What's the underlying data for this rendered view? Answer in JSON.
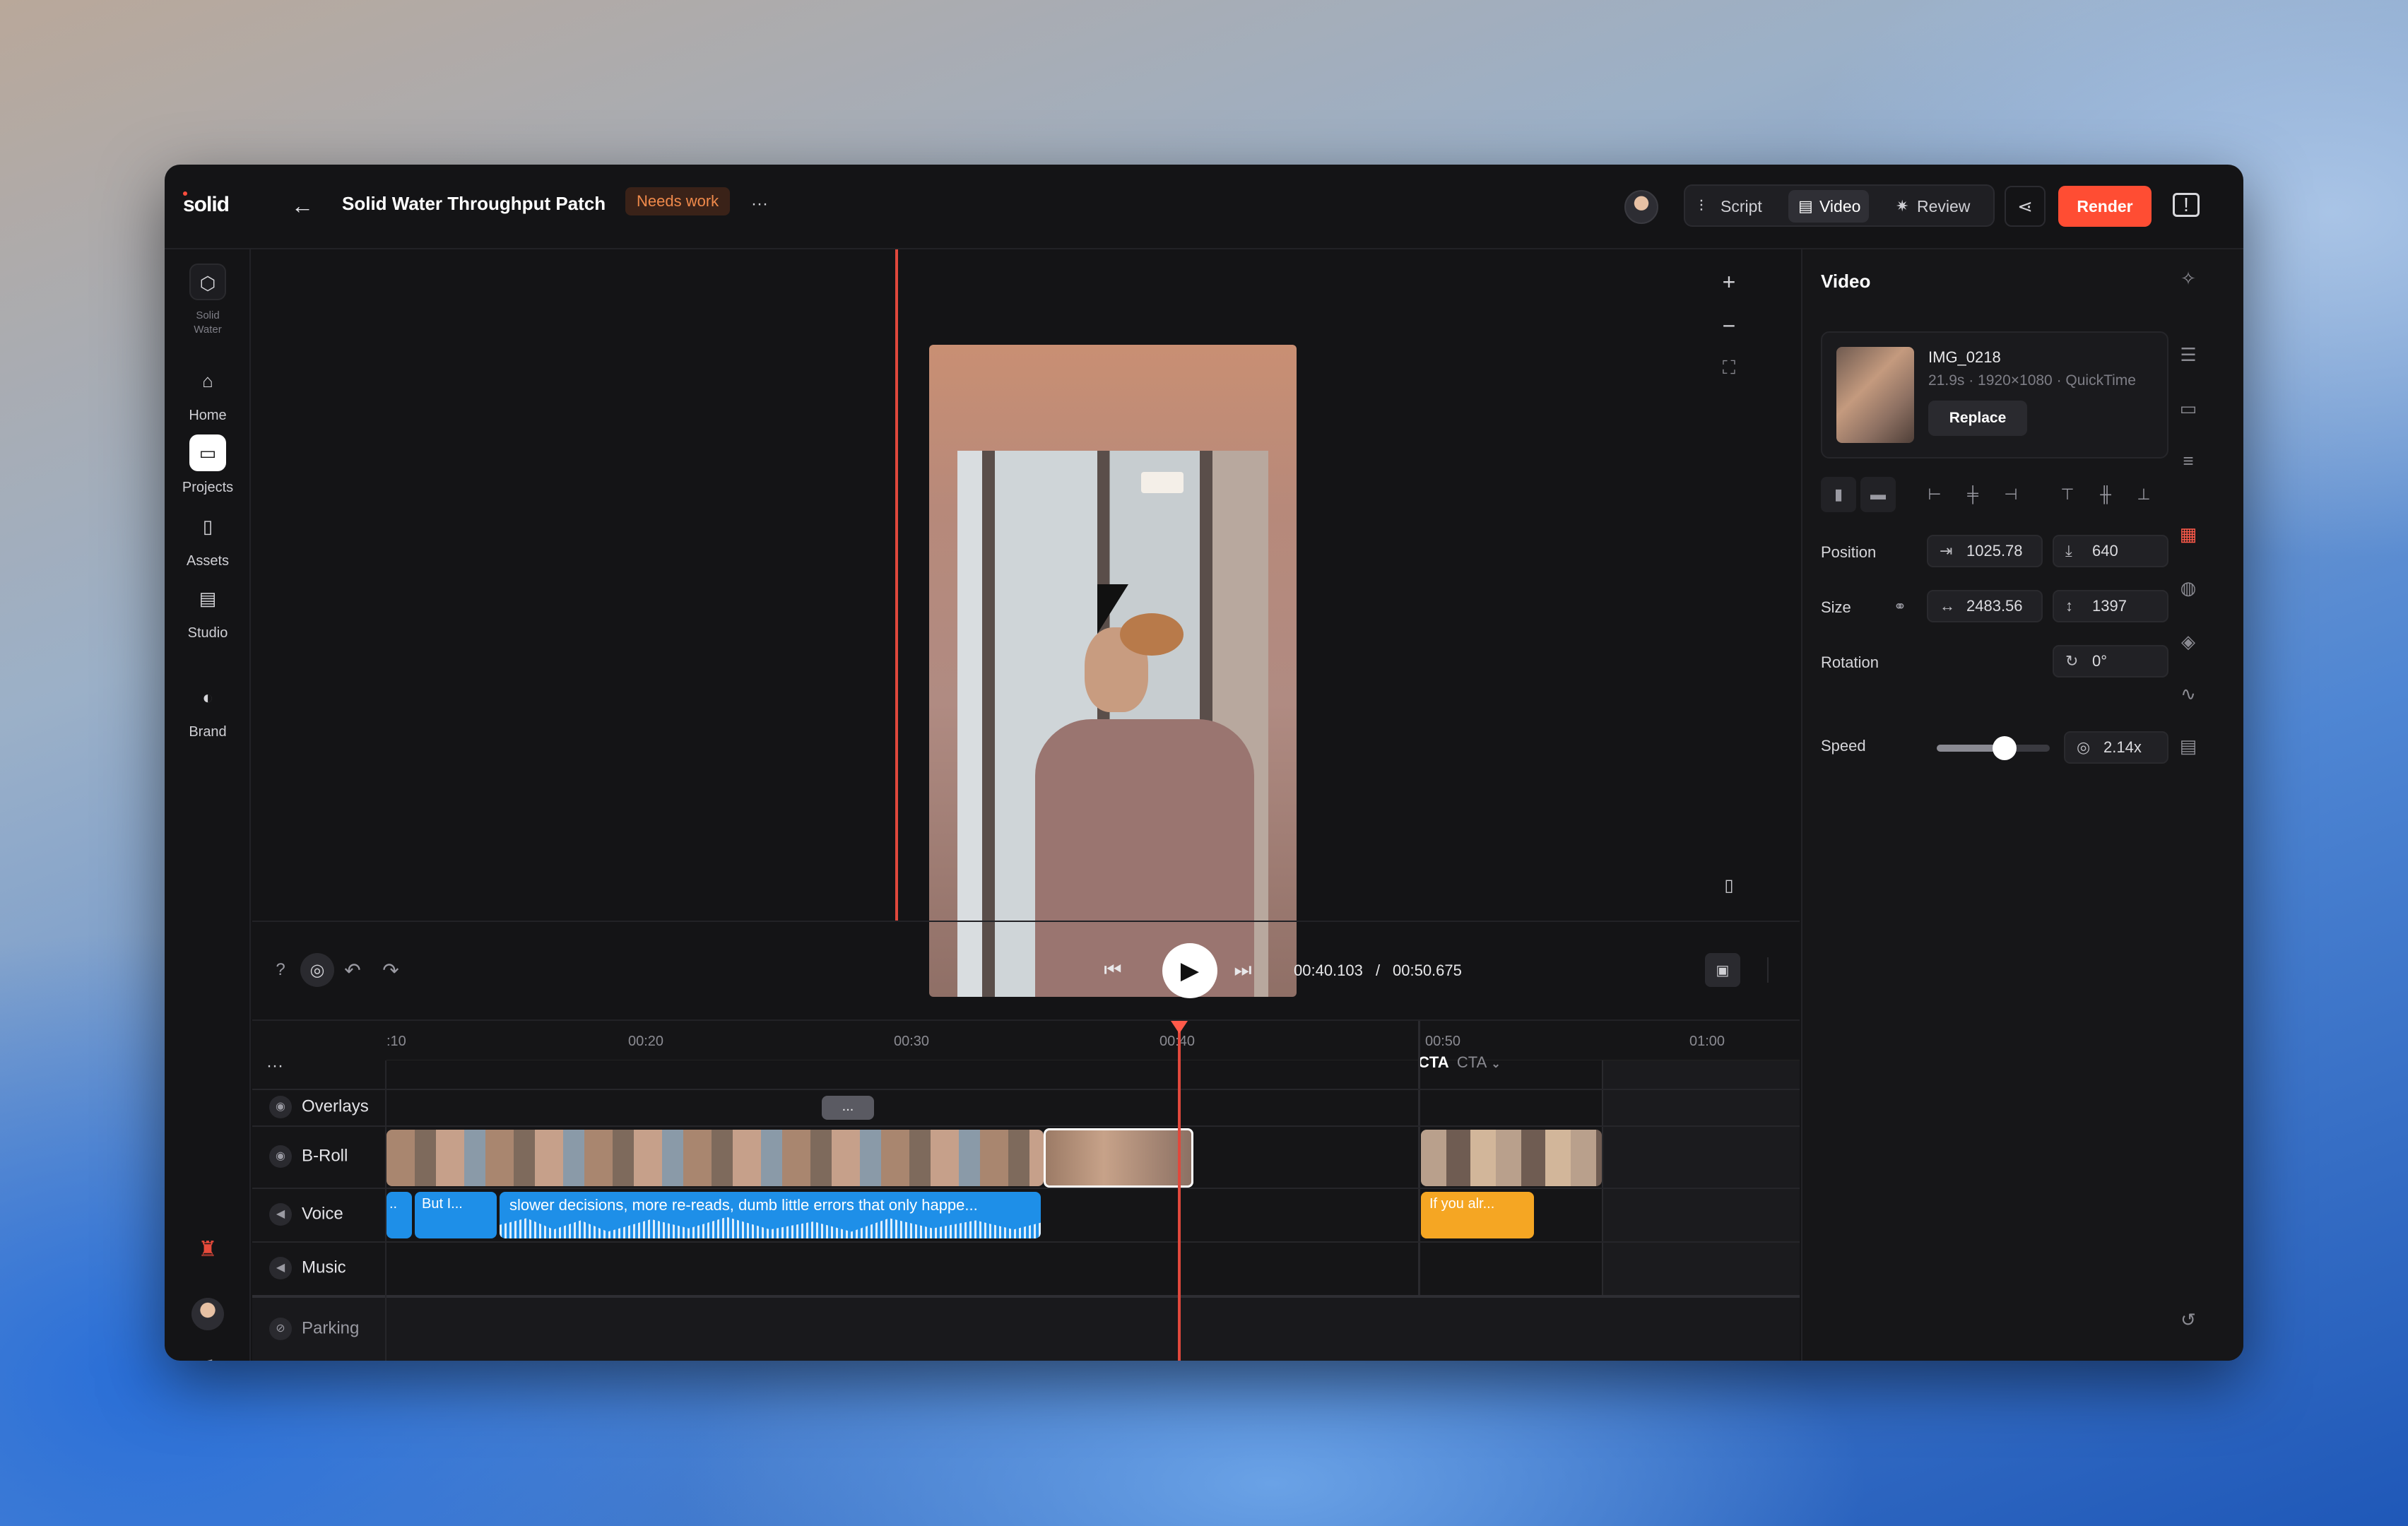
{
  "app": {
    "logo": "solid"
  },
  "header": {
    "title": "Solid Water Throughput Patch",
    "status": "Needs work",
    "more": "···",
    "tabs": [
      {
        "label": "Script",
        "icon": "waveform-icon"
      },
      {
        "label": "Video",
        "icon": "clapper-icon"
      },
      {
        "label": "Review",
        "icon": "sparkle-icon"
      }
    ],
    "render_label": "Render"
  },
  "nav": {
    "workspace": "Solid Water",
    "items": [
      {
        "label": "Home",
        "icon": "home-icon"
      },
      {
        "label": "Projects",
        "icon": "folder-icon"
      },
      {
        "label": "Assets",
        "icon": "file-icon"
      },
      {
        "label": "Studio",
        "icon": "clapper-icon"
      },
      {
        "label": "Brand",
        "icon": "brand-icon"
      }
    ]
  },
  "player": {
    "current": "00:40.103",
    "separator": "/",
    "duration": "00:50.675"
  },
  "timeline": {
    "more": "···",
    "ticks": [
      ":10",
      "00:20",
      "00:30",
      "00:40",
      "00:50",
      "01:00"
    ],
    "cta_label": "CTA",
    "cta_dropdown": "CTA",
    "overlay_chip": "...",
    "tracks": [
      {
        "label": "Overlays"
      },
      {
        "label": "B-Roll"
      },
      {
        "label": "Voice"
      },
      {
        "label": "Music"
      },
      {
        "label": "Parking"
      }
    ],
    "voice_clips": [
      {
        "text": ".."
      },
      {
        "text": "But I..."
      },
      {
        "text": "slower decisions, more re-reads, dumb little errors that only happe..."
      },
      {
        "text": "If you alr..."
      }
    ]
  },
  "panel": {
    "title": "Video",
    "asset": {
      "name": "IMG_0218",
      "meta": "21.9s · 1920×1080 · QuickTime",
      "replace_label": "Replace"
    },
    "position": {
      "label": "Position",
      "x": "1025.78",
      "y": "640"
    },
    "size": {
      "label": "Size",
      "w": "2483.56",
      "h": "1397"
    },
    "rotation": {
      "label": "Rotation",
      "value": "0°"
    },
    "speed": {
      "label": "Speed",
      "value": "2.14x",
      "slider_fraction": 0.6
    }
  },
  "colors": {
    "accent": "#ff4d33",
    "playhead": "#ff5a4a",
    "voice_clip": "#1e8fe8",
    "cta_clip": "#f5a623",
    "badge_text": "#f08a4b"
  }
}
